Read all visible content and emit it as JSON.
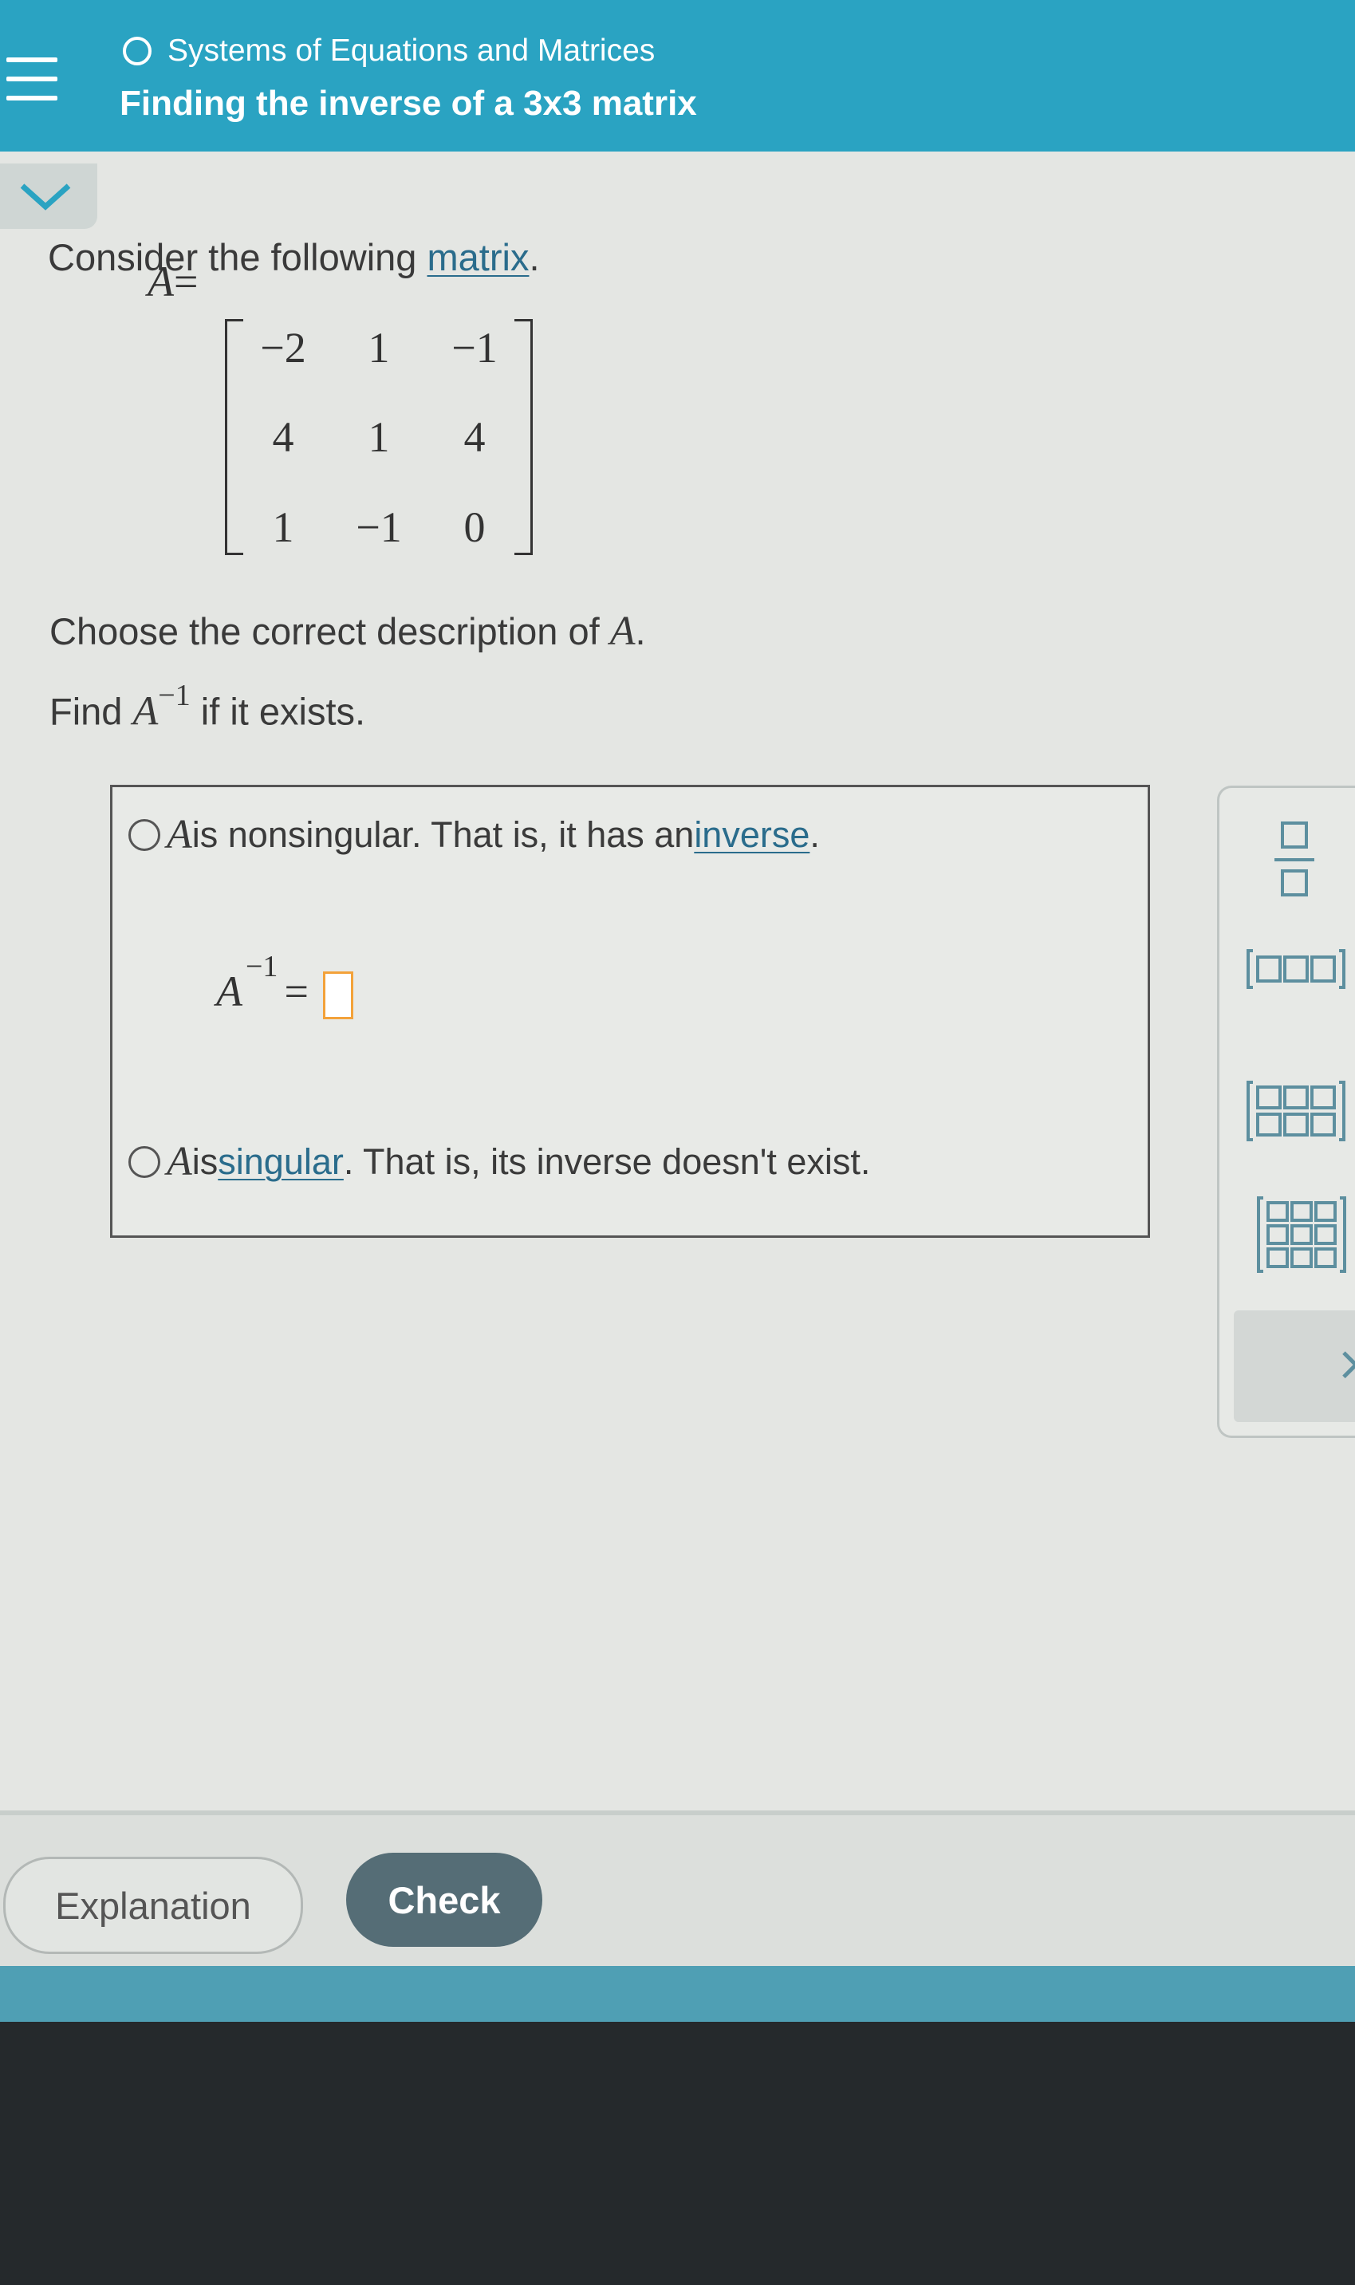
{
  "header": {
    "topic": "Systems of Equations and Matrices",
    "title": "Finding the inverse of a 3x3 matrix"
  },
  "problem": {
    "intro_text": "Consider the following ",
    "intro_link": "matrix",
    "intro_end": ".",
    "matrix_name": "A",
    "matrix_equals": "=",
    "matrix": [
      [
        "−2",
        "1",
        "−1"
      ],
      [
        "4",
        "1",
        "4"
      ],
      [
        "1",
        "−1",
        "0"
      ]
    ],
    "choose_text": "Choose the correct description of ",
    "choose_var": "A",
    "choose_end": ".",
    "find_text": "Find ",
    "find_var": "A",
    "find_sup": "−1",
    "find_end": " if it exists."
  },
  "options": {
    "nonsingular": {
      "var": "A",
      "text": " is nonsingular. That is, it has an ",
      "link": "inverse",
      "end": "."
    },
    "inverse_eq": {
      "var": "A",
      "sup": "−1",
      "eq": "="
    },
    "singular": {
      "var": "A",
      "text": " is ",
      "link": "singular",
      "end": ". That is, its inverse doesn't exist."
    }
  },
  "palette": {
    "buttons": [
      "fraction-icon",
      "row-matrix-icon",
      "matrix-2x3-icon",
      "matrix-3x3-icon"
    ],
    "clear": "×"
  },
  "footer": {
    "explanation_label": "Explanation",
    "check_label": "Check"
  },
  "colors": {
    "header_bg": "#2aa3c2",
    "link": "#2a6c8c",
    "check_bg": "#556d76",
    "input_border": "#f3a23a"
  }
}
